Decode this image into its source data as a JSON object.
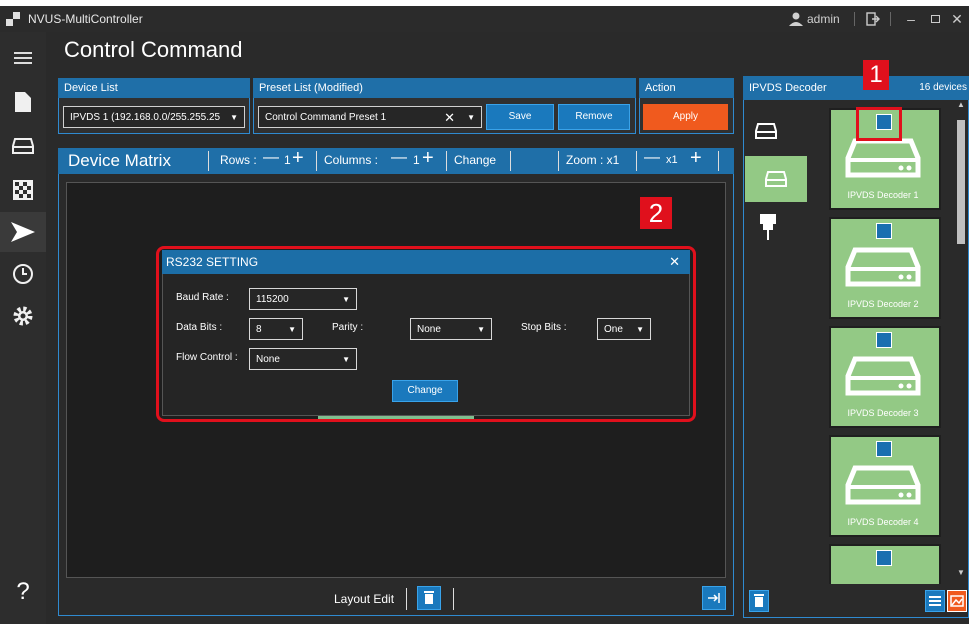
{
  "window": {
    "title": "NVUS-MultiController",
    "user": "admin"
  },
  "nav": {
    "items": [
      "menu",
      "file",
      "devices",
      "matrix",
      "control",
      "schedule",
      "settings"
    ],
    "help_label": "?"
  },
  "page": {
    "title": "Control Command"
  },
  "device_list": {
    "header": "Device List",
    "selected": "IPVDS 1 (192.168.0.0/255.255.25"
  },
  "preset_list": {
    "header": "Preset List (Modified)",
    "selected": "Control Command Preset 1",
    "save_label": "Save",
    "remove_label": "Remove"
  },
  "action": {
    "header": "Action",
    "apply_label": "Apply"
  },
  "device_matrix": {
    "title": "Device Matrix",
    "rows_label": "Rows :",
    "rows_value": "1",
    "columns_label": "Columns :",
    "columns_value": "1",
    "change_label": "Change",
    "zoom_label": "Zoom : x1",
    "zoom_value": "x1",
    "layout_edit_label": "Layout Edit"
  },
  "rs232_dialog": {
    "title": "RS232 SETTING",
    "baud_rate_label": "Baud Rate :",
    "baud_rate_value": "115200",
    "data_bits_label": "Data Bits :",
    "data_bits_value": "8",
    "parity_label": "Parity :",
    "parity_value": "None",
    "stop_bits_label": "Stop Bits :",
    "stop_bits_value": "One",
    "flow_control_label": "Flow Control :",
    "flow_control_value": "None",
    "change_label": "Change"
  },
  "decoder_panel": {
    "title": "IPVDS Decoder",
    "count": "16 devices",
    "decoders": [
      "IPVDS Decoder 1",
      "IPVDS Decoder 2",
      "IPVDS Decoder 3",
      "IPVDS Decoder 4"
    ]
  },
  "annotations": {
    "marker_1": "1",
    "marker_2": "2"
  },
  "colors": {
    "accent_blue": "#1f6fa8",
    "apply_orange": "#f05a1e",
    "tile_green": "#93c985",
    "highlight_red": "#e0101c"
  }
}
